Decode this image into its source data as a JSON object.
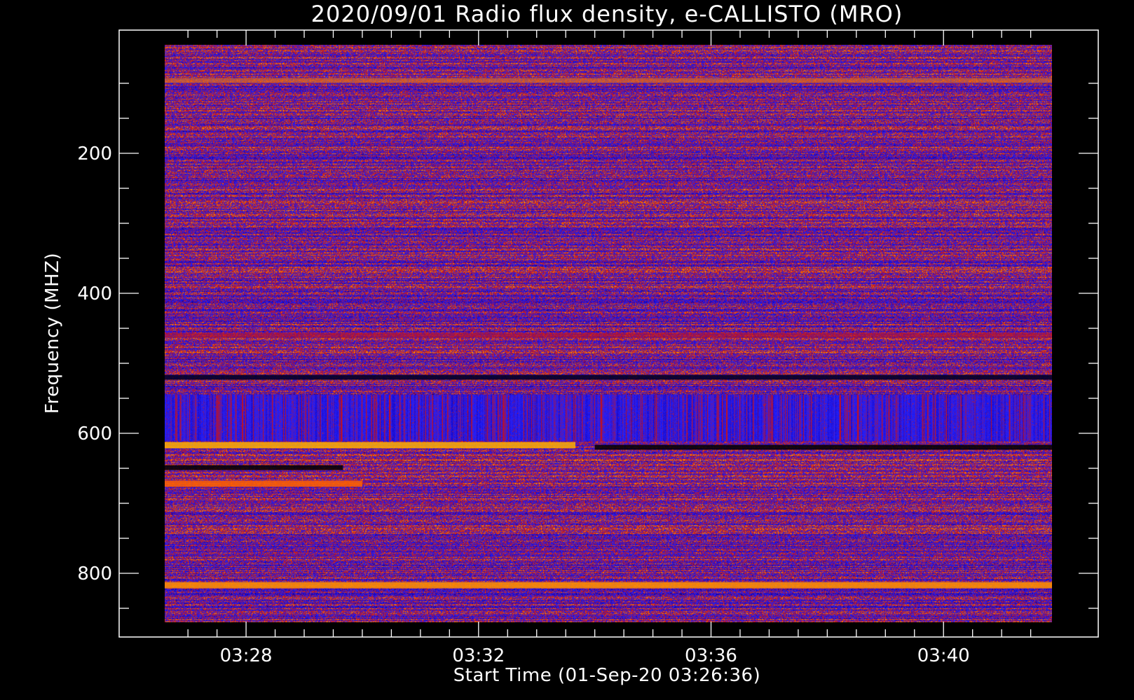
{
  "chart_data": {
    "type": "heatmap",
    "title": "2020/09/01  Radio flux density, e-CALLISTO (MRO)",
    "xlabel": "Start Time (01-Sep-20 03:26:36)",
    "ylabel": "Frequency (MHZ)",
    "x_range": [
      "03:26:36",
      "03:41:52"
    ],
    "y_range": [
      45,
      870
    ],
    "ylim": [
      45,
      870
    ],
    "y_axis_inverted": true,
    "x_ticks": [
      "03:28",
      "03:32",
      "03:36",
      "03:40"
    ],
    "y_ticks": [
      200,
      400,
      600,
      800
    ],
    "colormap": [
      "#000000",
      "#1a00b0",
      "#2020ff",
      "#c01020",
      "#ff8000",
      "#ffe000"
    ],
    "features": [
      {
        "type": "band",
        "freq_mhz": 617,
        "t_start": "03:26:36",
        "t_end": "03:33:40",
        "intensity": "high",
        "color": "#ffb000"
      },
      {
        "type": "band",
        "freq_mhz": 620,
        "t_start": "03:34:00",
        "t_end": "03:41:52",
        "intensity": "low",
        "color": "#000000"
      },
      {
        "type": "band",
        "freq_mhz": 672,
        "t_start": "03:26:36",
        "t_end": "03:30:00",
        "intensity": "high",
        "color": "#ff6000"
      },
      {
        "type": "band",
        "freq_mhz": 649,
        "t_start": "03:26:36",
        "t_end": "03:29:40",
        "intensity": "low",
        "color": "#000000"
      },
      {
        "type": "band",
        "freq_mhz": 817,
        "t_start": "03:26:36",
        "t_end": "03:41:52",
        "intensity": "high",
        "color": "#ff9000"
      },
      {
        "type": "band",
        "freq_mhz": 96,
        "t_start": "03:26:36",
        "t_end": "03:41:52",
        "intensity": "medium",
        "color": "#ff8000"
      },
      {
        "type": "band",
        "freq_mhz": 460,
        "t_start": "03:26:36",
        "t_end": "03:41:52",
        "intensity": "medium",
        "color": "#c01020"
      },
      {
        "type": "band",
        "freq_mhz": 520,
        "t_start": "03:26:36",
        "t_end": "03:41:52",
        "intensity": "low",
        "color": "#000020"
      },
      {
        "type": "region",
        "freq_start_mhz": 545,
        "freq_end_mhz": 610,
        "t_start": "03:26:36",
        "t_end": "03:41:52",
        "intensity": "striated",
        "color": "#5a10c8"
      }
    ]
  }
}
